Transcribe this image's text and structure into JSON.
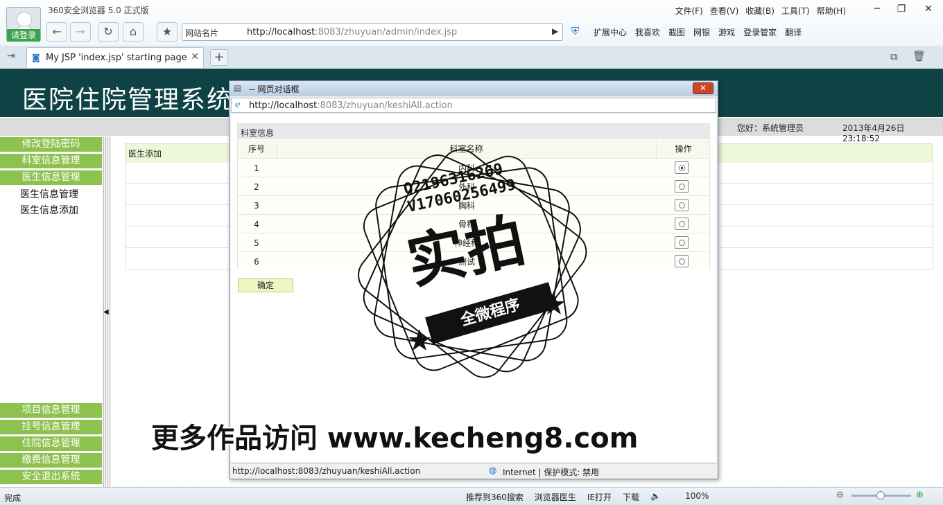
{
  "browser": {
    "app_title": "360安全浏览器 5.0 正式版",
    "login_label": "请登录",
    "menu": [
      "文件(F)",
      "查看(V)",
      "收藏(B)",
      "工具(T)",
      "帮助(H)"
    ],
    "sites_label": "网站名片",
    "url_host": "http://localhost",
    "url_rest": ":8083/zhuyuan/admin/index.jsp",
    "toolbar_items": [
      "扩展中心",
      "我喜欢",
      "截图",
      "网银",
      "游戏",
      "登录管家",
      "翻译"
    ],
    "tab_title": "My JSP 'index.jsp' starting page",
    "status_done": "完成",
    "status_items": [
      "推荐到360搜索",
      "浏览器医生",
      "IE打开",
      "下载",
      "100%"
    ]
  },
  "page": {
    "system_title": "医院住院管理系统",
    "greeting": "您好：系统管理员",
    "datetime": "2013年4月26日  23:18:52",
    "content_header": "医生添加",
    "sidebar_top": [
      "修改登陆密码",
      "科室信息管理",
      "医生信息管理"
    ],
    "sidebar_sub": [
      "医生信息管理",
      "医生信息添加"
    ],
    "sidebar_bottom": [
      "项目信息管理",
      "挂号信息管理",
      "住院信息管理",
      "缴费信息管理",
      "安全退出系统"
    ]
  },
  "dialog": {
    "title": "-- 网页对话框",
    "url_host": "http://localhost",
    "url_rest": ":8083/zhuyuan/keshiAll.action",
    "caption": "科室信息",
    "columns": [
      "序号",
      "科室名称",
      "操作"
    ],
    "rows": [
      {
        "num": "1",
        "name": "内科",
        "selected": true
      },
      {
        "num": "2",
        "name": "外科",
        "selected": false
      },
      {
        "num": "3",
        "name": "胸科",
        "selected": false
      },
      {
        "num": "4",
        "name": "骨科",
        "selected": false
      },
      {
        "num": "5",
        "name": "神经科",
        "selected": false
      },
      {
        "num": "6",
        "name": "测试",
        "selected": false
      }
    ],
    "ok_label": "确定",
    "status_url": "http://localhost:8083/zhuyuan/keshiAll.action",
    "status_zone": "Internet | 保护模式: 禁用"
  },
  "watermark": {
    "contact_q": "Q2196316269",
    "contact_v": "V17060256499",
    "big_text": "实拍",
    "ribbon_text": "全微程序",
    "bottom_text": "更多作品访问 www.kecheng8.com"
  }
}
